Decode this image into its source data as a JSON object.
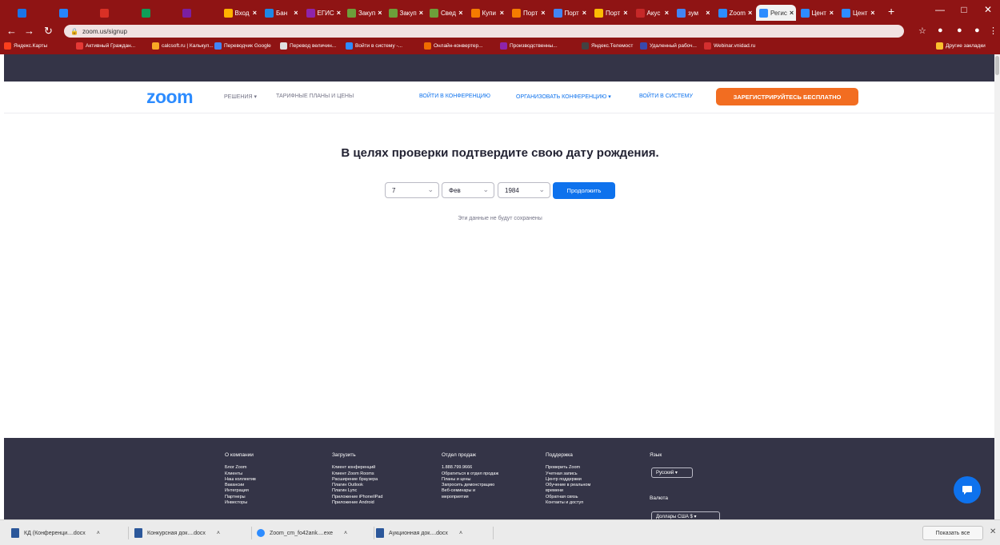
{
  "browser": {
    "tabs": [
      {
        "label": "",
        "color": "#1a73e8"
      },
      {
        "label": "",
        "color": "#2684fc"
      },
      {
        "label": "",
        "color": "#d93025"
      },
      {
        "label": "",
        "color": "#0f9d58"
      },
      {
        "label": "",
        "color": "#7b1fa2"
      },
      {
        "label": "Вход",
        "color": "#ffb300"
      },
      {
        "label": "Бан",
        "color": "#1e88e5"
      },
      {
        "label": "ЕГИС",
        "color": "#8e24aa"
      },
      {
        "label": "Закуп",
        "color": "#6d9f3a"
      },
      {
        "label": "Закуп",
        "color": "#6d9f3a"
      },
      {
        "label": "Свед",
        "color": "#6d9f3a"
      },
      {
        "label": "Купи",
        "color": "#f57c00"
      },
      {
        "label": "Порт",
        "color": "#f57c00"
      },
      {
        "label": "Порт",
        "color": "#4285f4"
      },
      {
        "label": "Порт",
        "color": "#fbbc04"
      },
      {
        "label": "Акус",
        "color": "#c62828"
      },
      {
        "label": "зум",
        "color": "#4285f4"
      },
      {
        "label": "Zoom",
        "color": "#2d8cff"
      },
      {
        "label": "Регис",
        "color": "#2d8cff",
        "active": true
      },
      {
        "label": "Цент",
        "color": "#2d8cff"
      },
      {
        "label": "Цент",
        "color": "#2d8cff"
      }
    ],
    "url": "zoom.us/signup",
    "bookmarks": [
      {
        "label": "Яндекс.Карты",
        "color": "#fc3f1d"
      },
      {
        "label": "Активный Граждан...",
        "color": "#e53935"
      },
      {
        "label": "calcsoft.ru | Калькул...",
        "color": "#f9a825"
      },
      {
        "label": "Переводчик Google",
        "color": "#4285f4"
      },
      {
        "label": "Перевод величин...",
        "color": "#e0e0e0"
      },
      {
        "label": "Войти в систему -...",
        "color": "#2d8cff"
      },
      {
        "label": "Онлайн-конвертер...",
        "color": "#ef6c00"
      },
      {
        "label": "Производственны...",
        "color": "#8e24aa"
      },
      {
        "label": "Яндекс.Телемост",
        "color": "#424242"
      },
      {
        "label": "Удаленный рабоч...",
        "color": "#3949ab"
      },
      {
        "label": "Webinar.vnidad.ru",
        "color": "#d32f2f"
      },
      {
        "label": "Другие закладки",
        "color": "#fbc02d"
      }
    ]
  },
  "zoom": {
    "logo": "zoom",
    "nav": {
      "solutions": "РЕШЕНИЯ",
      "plans": "ТАРИФНЫЕ ПЛАНЫ И ЦЕНЫ",
      "join": "ВОЙТИ В КОНФЕРЕНЦИЮ",
      "host": "ОРГАНИЗОВАТЬ КОНФЕРЕНЦИЮ",
      "signin": "ВОЙТИ В СИСТЕМУ",
      "signup": "ЗАРЕГИСТРИРУЙТЕСЬ БЕСПЛАТНО"
    },
    "main": {
      "heading": "В целях проверки подтвердите свою дату рождения.",
      "day": "7",
      "month": "Фев",
      "year": "1984",
      "continue": "Продолжить",
      "note": "Эти данные не будут сохранены"
    },
    "footer": {
      "columns": [
        {
          "title": "О компании",
          "items": [
            "Блог Zoom",
            "Клиенты",
            "Наш коллектив",
            "Вакансии",
            "Интеграция",
            "Партнеры",
            "Инвесторы"
          ]
        },
        {
          "title": "Загрузить",
          "items": [
            "Клиент конференций",
            "Клиент Zoom Rooms",
            "Расширение браузера",
            "Плагин Outlook",
            "Плагин Lync",
            "Приложение iPhone/iPad",
            "Приложение Android"
          ]
        },
        {
          "title": "Отдел продаж",
          "items": [
            "1.888.799.9666",
            "Обратиться в отдел продаж",
            "Планы и цены",
            "Запросить демонстрацию",
            "Веб-семинары и",
            "мероприятия"
          ]
        },
        {
          "title": "Поддержка",
          "items": [
            "Проверить Zoom",
            "Учетная запись",
            "Центр поддержки",
            "Обучение в реальном",
            "времени",
            "Обратная связь",
            "Контакты и доступ"
          ]
        }
      ],
      "language_title": "Язык",
      "language_value": "Русский",
      "currency_title": "Валюта",
      "currency_value": "Доллары США $"
    }
  },
  "downloads": {
    "items": [
      {
        "label": "КД (Конференци....docx",
        "type": "word"
      },
      {
        "label": "Конкурсная док....docx",
        "type": "word"
      },
      {
        "label": "Zoom_cm_fo42ank....exe",
        "type": "zoom"
      },
      {
        "label": "Аукционная док....docx",
        "type": "word"
      }
    ],
    "show_all": "Показать все"
  }
}
